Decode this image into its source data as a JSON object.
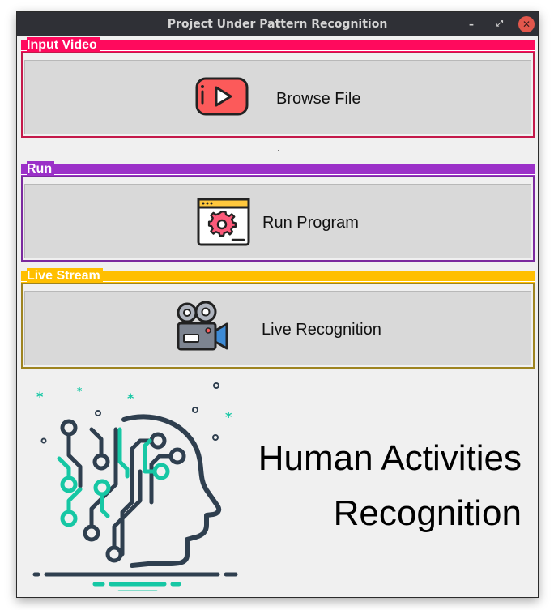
{
  "window": {
    "title": "Project Under Pattern Recognition",
    "minimize_glyph": "–",
    "maximize_glyph": "⤢",
    "close_glyph": "✕"
  },
  "groups": [
    {
      "title": "Input Video",
      "color": "#ff0a5d",
      "border_color": "#c4194a",
      "button_label": "Browse File",
      "icon": "youtube-play-icon"
    },
    {
      "title": "Run",
      "color": "#9b30c8",
      "border_color": "#7b2a9f",
      "button_label": "Run Program",
      "icon": "gear-window-icon"
    },
    {
      "title": "Live Stream",
      "color": "#ffbf00",
      "border_color": "#9e8420",
      "button_label": "Live Recognition",
      "icon": "video-camera-icon"
    }
  ],
  "hero": {
    "line1": "Human Activities",
    "line2": "Recognition",
    "icon": "ai-head-circuit-icon",
    "accent_color": "#16c7a4",
    "dark_color": "#2f3f4f"
  }
}
